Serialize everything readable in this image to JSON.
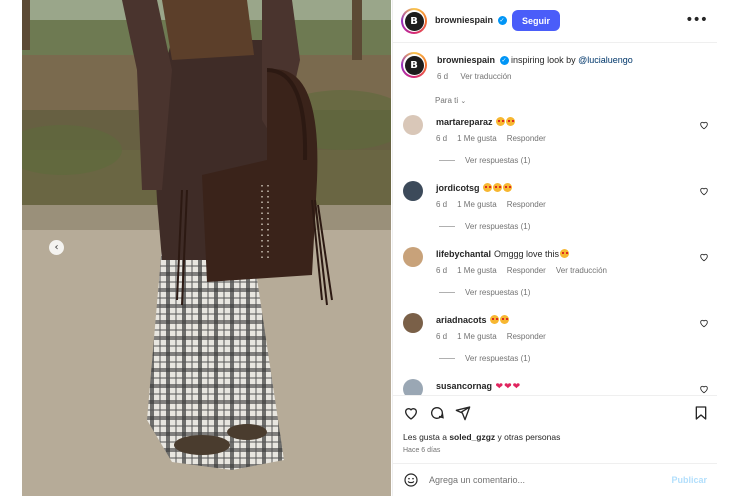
{
  "post": {
    "account": "browniespain",
    "avatar_letter": "B",
    "follow_label": "Seguir",
    "separator": "•",
    "more_icon": "more-horizontal-icon",
    "caption": {
      "username": "browniespain",
      "text": "inspiring look by",
      "mention": "@lucialuengo",
      "age": "6 d",
      "translate": "Ver traducción"
    },
    "sort_label": "Para ti",
    "likes_prefix": "Les gusta a",
    "likes_user": "soled_gzgz",
    "likes_suffix": "y otras personas",
    "date_label": "Hace 6 días",
    "comment_placeholder": "Agrega un comentario...",
    "publish_label": "Publicar"
  },
  "comments": [
    {
      "username": "martareparaz",
      "text": "",
      "age": "6 d",
      "likes": "1 Me gusta",
      "reply": "Responder",
      "translate": "",
      "replies": "Ver respuestas (1)",
      "emoji": "heart-eyes-emoji",
      "emoji_count": 2,
      "avatar_color": "#d9c7b8"
    },
    {
      "username": "jordicotsg",
      "text": "",
      "age": "6 d",
      "likes": "1 Me gusta",
      "reply": "Responder",
      "translate": "",
      "replies": "Ver respuestas (1)",
      "emoji": "heart-eyes-emoji",
      "emoji_count": 3,
      "avatar_color": "#3c4a5a"
    },
    {
      "username": "lifebychantal",
      "text": "Omggg love this",
      "age": "6 d",
      "likes": "1 Me gusta",
      "reply": "Responder",
      "translate": "Ver traducción",
      "replies": "Ver respuestas (1)",
      "emoji": "heart-eyes-emoji",
      "emoji_count": 1,
      "avatar_color": "#c8a27a"
    },
    {
      "username": "ariadnacots",
      "text": "",
      "age": "6 d",
      "likes": "1 Me gusta",
      "reply": "Responder",
      "translate": "",
      "replies": "Ver respuestas (1)",
      "emoji": "heart-eyes-emoji",
      "emoji_count": 2,
      "avatar_color": "#7a6048"
    },
    {
      "username": "susancornag",
      "text": "",
      "age": "",
      "likes": "",
      "reply": "",
      "translate": "",
      "replies": "",
      "emoji": "red-heart-emoji",
      "emoji_count": 3,
      "avatar_color": "#9aa7b4"
    }
  ],
  "colors": {
    "accent": "#4a5df9",
    "verified": "#0095f6",
    "mention": "#00376b",
    "muted": "#737373"
  }
}
